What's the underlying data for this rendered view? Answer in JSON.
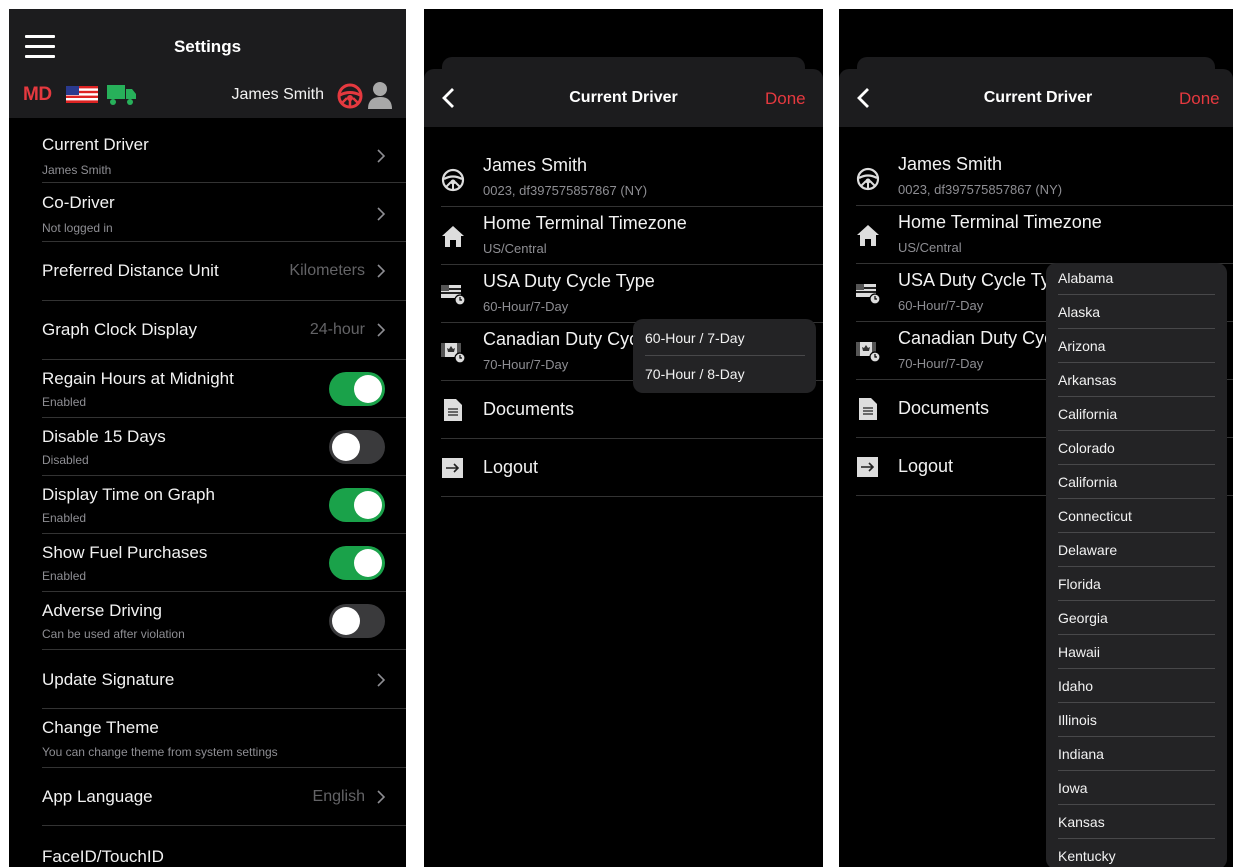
{
  "settings": {
    "title": "Settings",
    "brand": "MD",
    "driver_name": "James Smith",
    "rows": [
      {
        "title": "Current Driver",
        "subtitle": "James Smith"
      },
      {
        "title": "Co-Driver",
        "subtitle": "Not logged in"
      },
      {
        "title": "Preferred Distance Unit",
        "value": "Kilometers"
      },
      {
        "title": "Graph Clock Display",
        "value": "24-hour"
      },
      {
        "title": "Regain Hours at Midnight",
        "subtitle": "Enabled",
        "toggle": "on"
      },
      {
        "title": "Disable 15 Days",
        "subtitle": "Disabled",
        "toggle": "off"
      },
      {
        "title": "Display Time on Graph",
        "subtitle": "Enabled",
        "toggle": "on"
      },
      {
        "title": "Show Fuel Purchases",
        "subtitle": "Enabled",
        "toggle": "on"
      },
      {
        "title": "Adverse Driving",
        "subtitle": "Can be used after violation",
        "toggle": "off"
      },
      {
        "title": "Update Signature"
      },
      {
        "title": "Change Theme",
        "subtitle": "You can change theme from system settings"
      },
      {
        "title": "App Language",
        "value": "English"
      },
      {
        "title": "FaceID/TouchID"
      }
    ]
  },
  "current_driver": {
    "title": "Current Driver",
    "done_label": "Done",
    "items": [
      {
        "icon": "steering-wheel-icon",
        "title": "James Smith",
        "subtitle": "0023, df397575857867 (NY)"
      },
      {
        "icon": "home-icon",
        "title": "Home Terminal Timezone",
        "subtitle": "US/Central"
      },
      {
        "icon": "us-flag-clock-icon",
        "title": "USA Duty Cycle Type",
        "subtitle": "60-Hour/7-Day"
      },
      {
        "icon": "canada-flag-clock-icon",
        "title": "Canadian Duty Cycle",
        "subtitle": "70-Hour/7-Day"
      },
      {
        "icon": "document-icon",
        "title": "Documents"
      },
      {
        "icon": "logout-icon",
        "title": "Logout"
      }
    ],
    "duty_cycle_options": [
      "60-Hour / 7-Day",
      "70-Hour / 8-Day"
    ],
    "state_options": [
      "Alabama",
      "Alaska",
      "Arizona",
      "Arkansas",
      "California",
      "Colorado",
      "California",
      "Connecticut",
      "Delaware",
      "Florida",
      "Georgia",
      "Hawaii",
      "Idaho",
      "Illinois",
      "Indiana",
      "Iowa",
      "Kansas",
      "Kentucky"
    ]
  },
  "colors": {
    "accent": "#e5393f",
    "toggle_on": "#1aa24a",
    "background": "#000000",
    "header": "#1c1c1e"
  }
}
